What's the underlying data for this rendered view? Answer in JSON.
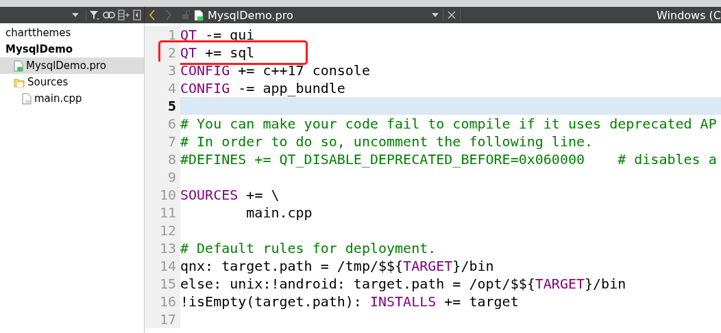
{
  "toolbar": {
    "document_title": "MysqlDemo.pro",
    "back_enabled": true,
    "forward_enabled": false,
    "encoding_label": "Windows (C"
  },
  "project_tree": [
    {
      "label": "chartthemes",
      "kind": "project",
      "selected": false
    },
    {
      "label": "MysqlDemo",
      "kind": "project",
      "selected": false,
      "children": [
        {
          "label": "MysqlDemo.pro",
          "kind": "pro",
          "selected": true
        },
        {
          "label": "Sources",
          "kind": "folder",
          "selected": false,
          "children": [
            {
              "label": "main.cpp",
              "kind": "cpp",
              "selected": false
            }
          ]
        }
      ]
    }
  ],
  "editor": {
    "lines": [
      {
        "number": "1",
        "current": false,
        "boxed": false,
        "tokens": [
          {
            "text": "QT",
            "kind": "keyword"
          },
          {
            "text": " -= gui",
            "kind": "plain"
          }
        ]
      },
      {
        "number": "2",
        "current": false,
        "boxed": true,
        "tokens": [
          {
            "text": "QT",
            "kind": "keyword"
          },
          {
            "text": " += sql",
            "kind": "plain"
          }
        ]
      },
      {
        "number": "3",
        "current": false,
        "boxed": false,
        "tokens": [
          {
            "text": "CONFIG",
            "kind": "keyword"
          },
          {
            "text": " += c++17 console",
            "kind": "plain"
          }
        ]
      },
      {
        "number": "4",
        "current": false,
        "boxed": false,
        "tokens": [
          {
            "text": "CONFIG",
            "kind": "keyword"
          },
          {
            "text": " -= app_bundle",
            "kind": "plain"
          }
        ]
      },
      {
        "number": "5",
        "current": true,
        "boxed": false
      },
      {
        "number": "6",
        "current": false,
        "boxed": false,
        "tokens": [
          {
            "text": "# You can make your code fail to compile if it uses deprecated AP",
            "kind": "comment"
          }
        ]
      },
      {
        "number": "7",
        "current": false,
        "boxed": false,
        "tokens": [
          {
            "text": "# In order to do so, uncomment the following line.",
            "kind": "comment"
          }
        ]
      },
      {
        "number": "8",
        "current": false,
        "boxed": false,
        "tokens": [
          {
            "text": "#DEFINES += QT_DISABLE_DEPRECATED_BEFORE=0x060000    # disables a",
            "kind": "comment"
          }
        ]
      },
      {
        "number": "9",
        "current": false,
        "boxed": false
      },
      {
        "number": "10",
        "current": false,
        "boxed": false,
        "tokens": [
          {
            "text": "SOURCES",
            "kind": "keyword"
          },
          {
            "text": " += \\",
            "kind": "plain"
          }
        ]
      },
      {
        "number": "11",
        "current": false,
        "boxed": false,
        "tokens": [
          {
            "text": "        main.cpp",
            "kind": "plain"
          }
        ]
      },
      {
        "number": "12",
        "current": false,
        "boxed": false
      },
      {
        "number": "13",
        "current": false,
        "boxed": false,
        "tokens": [
          {
            "text": "# Default rules for deployment.",
            "kind": "comment"
          }
        ]
      },
      {
        "number": "14",
        "current": false,
        "boxed": false,
        "tokens": [
          {
            "text": "qnx: target.path = /tmp/$${",
            "kind": "plain"
          },
          {
            "text": "TARGET",
            "kind": "keyword"
          },
          {
            "text": "}/bin",
            "kind": "plain"
          }
        ]
      },
      {
        "number": "15",
        "current": false,
        "boxed": false,
        "tokens": [
          {
            "text": "else: unix:!android: target.path = /opt/$${",
            "kind": "plain"
          },
          {
            "text": "TARGET",
            "kind": "keyword"
          },
          {
            "text": "}/bin",
            "kind": "plain"
          }
        ]
      },
      {
        "number": "16",
        "current": false,
        "boxed": false,
        "tokens": [
          {
            "text": "!isEmpty(target.path): ",
            "kind": "plain"
          },
          {
            "text": "INSTALLS",
            "kind": "keyword"
          },
          {
            "text": " += target",
            "kind": "plain"
          }
        ]
      },
      {
        "number": "17",
        "current": false,
        "boxed": false
      }
    ]
  }
}
